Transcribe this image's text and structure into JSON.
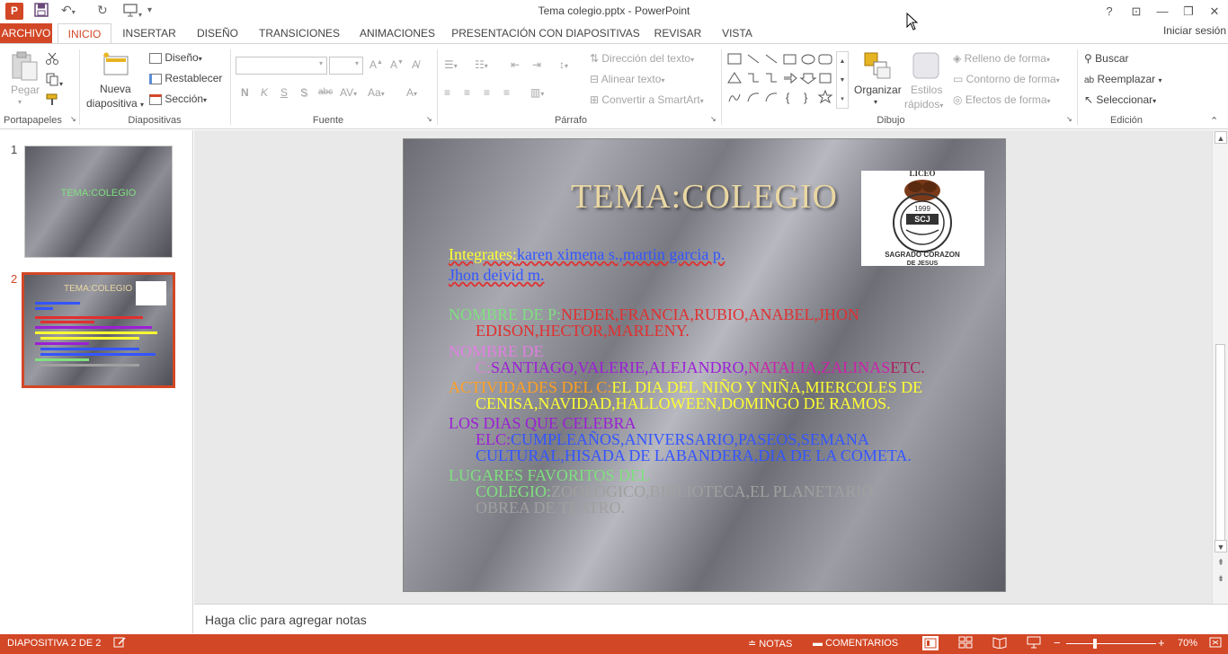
{
  "window": {
    "title": "Tema colegio.pptx - PowerPoint",
    "app_icon": "P",
    "qat": {
      "save_icon": "save-icon",
      "undo_icon": "undo-icon",
      "redo_icon": "redo-icon",
      "start_icon": "start-from-beginning-icon"
    },
    "controls": {
      "help": "?",
      "ribbon_options": "⊡",
      "minimize": "—",
      "restore": "❐",
      "close": "✕"
    }
  },
  "tabs": [
    "ARCHIVO",
    "INICIO",
    "INSERTAR",
    "DISEÑO",
    "TRANSICIONES",
    "ANIMACIONES",
    "PRESENTACIÓN CON DIAPOSITIVAS",
    "REVISAR",
    "VISTA"
  ],
  "active_tab": "INICIO",
  "signin": "Iniciar sesión",
  "ribbon": {
    "portapapeles": {
      "label": "Portapapeles",
      "paste": "Pegar"
    },
    "diapositivas": {
      "label": "Diapositivas",
      "new_slide_1": "Nueva",
      "new_slide_2": "diapositiva",
      "layout": "Diseño",
      "reset": "Restablecer",
      "section": "Sección"
    },
    "fuente": {
      "label": "Fuente",
      "bold": "N",
      "italic": "K",
      "underline": "S",
      "shadow": "S",
      "strike": "abc",
      "spacing": "AV",
      "case": "Aa"
    },
    "parrafo": {
      "label": "Párrafo",
      "text_direction": "Dirección del texto",
      "align_text": "Alinear texto",
      "smartart": "Convertir a SmartArt"
    },
    "dibujo": {
      "label": "Dibujo",
      "arrange": "Organizar",
      "quick_styles_1": "Estilos",
      "quick_styles_2": "rápidos",
      "fill": "Relleno de forma",
      "outline": "Contorno de forma",
      "effects": "Efectos de forma"
    },
    "edicion": {
      "label": "Edición",
      "find": "Buscar",
      "replace": "Reemplazar",
      "select": "Seleccionar"
    }
  },
  "thumbnails": [
    {
      "number": "1",
      "title": "TEMA:COLEGIO"
    },
    {
      "number": "2",
      "title": "TEMA:COLEGIO"
    }
  ],
  "slide": {
    "title": "TEMA:COLEGIO",
    "logo_text": "LICEO 1999 SCJ SAGRADO CORAZÓN DE JESÚS",
    "integrantes_label": "Integrates:",
    "integrantes_value": "karen ximena s.,martin garcia p.",
    "integrantes_value2": "Jhon deivid m.",
    "nombre_p_label": "NOMBRE DE P:",
    "nombre_p_value1": "NEDER,FRANCIA,RUBIO,ANABEL,JHON",
    "nombre_p_value2": "EDISON,HECTOR,MARLENY.",
    "nombre_c_label1": "NOMBRE DE",
    "nombre_c_label2": "C:",
    "nombre_c_value_a": "SANTIAGO,VALERIE,ALEJANDRO,",
    "nombre_c_value_b": "NATALIA,ZALINAS",
    "nombre_c_value_c": "ETC.",
    "actividades_label": "ACTIVIDADES DEL C:",
    "actividades_value1": "EL DIA DEL NIÑO Y NIÑA,MIERCOLES DE",
    "actividades_value2": "CENISA,NAVIDAD,HALLOWEEN,DOMINGO DE RAMOS.",
    "dias_label1": "LOS DIAS QUE CELEBRA",
    "dias_label2": "ELC:",
    "dias_value1": "CUMPLEAÑOS,ANIVERSARIO,PASEOS,SEMANA",
    "dias_value2": "CULTURAL,HISADA DE LABANDERA,DIA DE LA COMETA.",
    "lugares_label1": "LUGARES  FAVORITOS DEL",
    "lugares_label2": "COLEGIO:",
    "lugares_value1": "ZOOLOGICO,BIBLIOTECA,EL PLANETARIO,",
    "lugares_value2": "OBREA DE TEATRO."
  },
  "notes_placeholder": "Haga clic para agregar notas",
  "status": {
    "slide_info": "DIAPOSITIVA 2 DE 2",
    "notes": "NOTAS",
    "comments": "COMENTARIOS",
    "zoom": "70%",
    "minus": "−",
    "plus": "+"
  },
  "colors": {
    "accent": "#d24726",
    "yellow": "#ffff33",
    "blue": "#3355ff",
    "green": "#7fe07f",
    "red": "#e03030",
    "pink": "#e080e0",
    "purple": "#9b1fd6",
    "orange": "#ffa020",
    "gray_text": "#a0a0a0"
  }
}
